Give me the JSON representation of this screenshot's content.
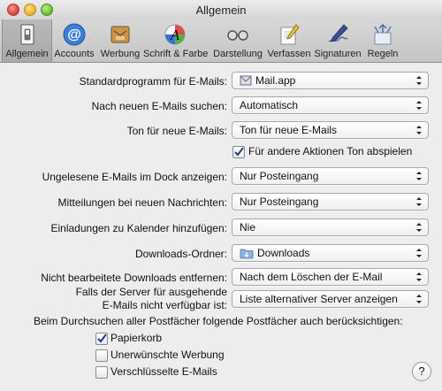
{
  "window": {
    "title": "Allgemein"
  },
  "toolbar": [
    {
      "label": "Allgemein",
      "icon": "switch-icon"
    },
    {
      "label": "Accounts",
      "icon": "at-sign-icon"
    },
    {
      "label": "Werbung",
      "icon": "junk-mail-icon"
    },
    {
      "label": "Schrift & Farbe",
      "icon": "fonts-colors-icon"
    },
    {
      "label": "Darstellung",
      "icon": "viewing-glasses-icon"
    },
    {
      "label": "Verfassen",
      "icon": "composing-pencil-icon"
    },
    {
      "label": "Signaturen",
      "icon": "signature-pen-icon"
    },
    {
      "label": "Regeln",
      "icon": "rules-arrows-icon"
    }
  ],
  "settings": {
    "default_mail_label": "Standardprogramm für E-Mails:",
    "default_mail_value": "Mail.app",
    "check_label": "Nach neuen E-Mails suchen:",
    "check_value": "Automatisch",
    "sound_label": "Ton für neue E-Mails:",
    "sound_value": "Ton für neue E-Mails",
    "other_sounds_label": "Für andere Aktionen Ton abspielen",
    "dock_label": "Ungelesene E-Mails im Dock anzeigen:",
    "dock_value": "Nur Posteingang",
    "notify_label": "Mitteilungen bei neuen Nachrichten:",
    "notify_value": "Nur Posteingang",
    "calendar_label": "Einladungen zu Kalender hinzufügen:",
    "calendar_value": "Nie",
    "downloads_label": "Downloads-Ordner:",
    "downloads_value": "Downloads",
    "remove_label": "Nicht bearbeitete Downloads entfernen:",
    "remove_value": "Nach dem Löschen der E-Mail",
    "server_label_1": "Falls der Server für ausgehende",
    "server_label_2": "E-Mails nicht verfügbar ist:",
    "server_value": "Liste alternativer Server anzeigen",
    "search_header": "Beim Durchsuchen aller Postfächer folgende Postfächer auch berücksichtigen:",
    "trash_label": "Papierkorb",
    "junk_label": "Unerwünschte Werbung",
    "encrypted_label": "Verschlüsselte E-Mails"
  },
  "help_label": "?"
}
